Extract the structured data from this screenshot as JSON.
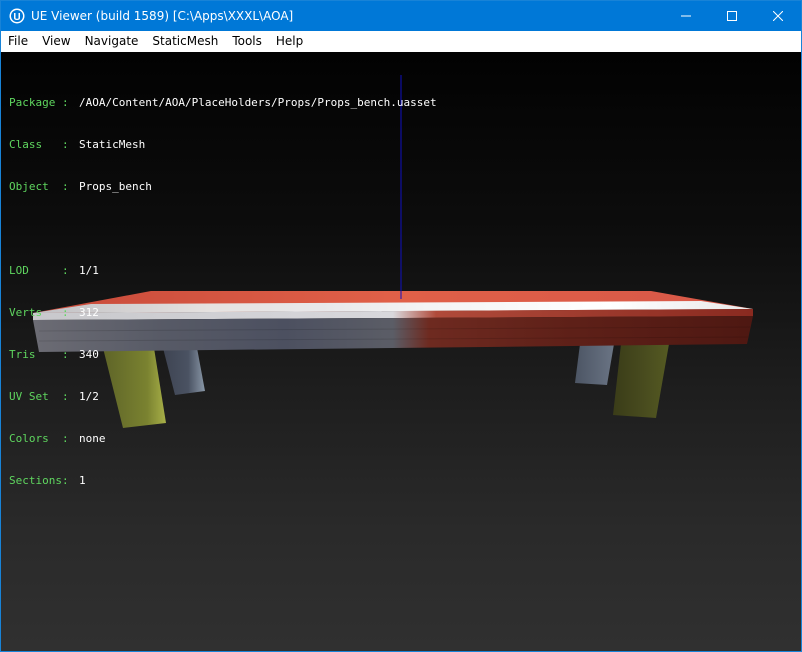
{
  "window": {
    "title": "UE Viewer (build 1589) [C:\\Apps\\XXXL\\AOA]"
  },
  "menu": [
    "File",
    "View",
    "Navigate",
    "StaticMesh",
    "Tools",
    "Help"
  ],
  "info_block": {
    "object_rows": [
      {
        "label": "Package :",
        "value": "/AOA/Content/AOA/PlaceHolders/Props/Props_bench.uasset"
      },
      {
        "label": "Class   :",
        "value": "StaticMesh"
      },
      {
        "label": "Object  :",
        "value": "Props_bench"
      }
    ],
    "mesh_rows": [
      {
        "label": "LOD     :",
        "value": "1/1"
      },
      {
        "label": "Verts   :",
        "value": "312"
      },
      {
        "label": "Tris    :",
        "value": "340"
      },
      {
        "label": "UV Set  :",
        "value": "1/2"
      },
      {
        "label": "Colors  :",
        "value": "none"
      },
      {
        "label": "Sections:",
        "value": "1"
      }
    ]
  },
  "colors": {
    "titlebar": "#0078d7",
    "label_green": "#5fd65f",
    "value_white": "#ffffff",
    "axis_blue": "#1010c0"
  },
  "icons": {
    "app": "unreal-engine-icon",
    "minimize": "minimize-icon",
    "maximize": "maximize-icon",
    "close": "close-icon"
  }
}
